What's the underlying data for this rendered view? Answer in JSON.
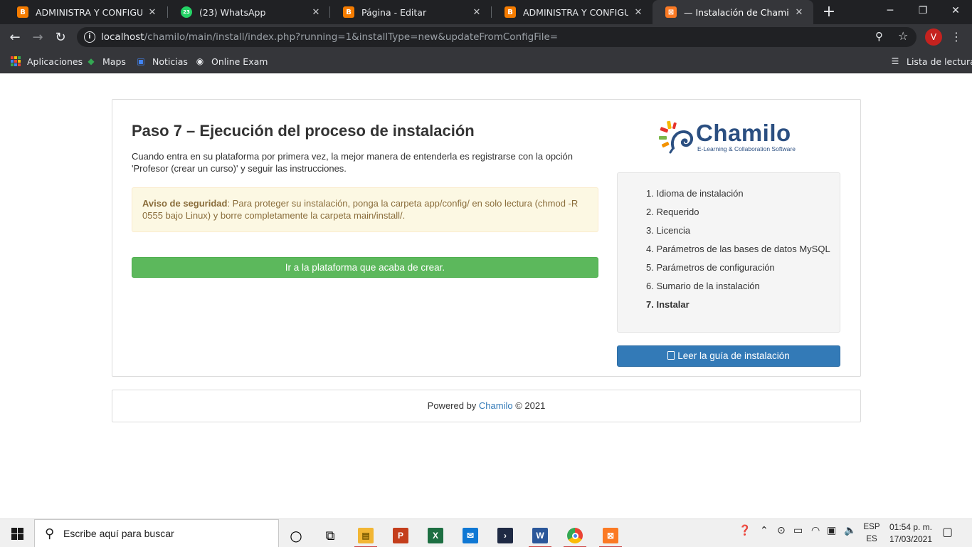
{
  "browser": {
    "tabs": [
      {
        "title": "ADMINISTRA Y CONFIGURA PL",
        "favicon": "blogger-icon"
      },
      {
        "title": "(23) WhatsApp",
        "favicon": "whatsapp-icon",
        "badge": "23"
      },
      {
        "title": "Página - Editar",
        "favicon": "blogger-icon"
      },
      {
        "title": "ADMINISTRA Y CONFIGURA PL",
        "favicon": "blogger-icon"
      },
      {
        "title": "— Instalación de Chamilo — V",
        "favicon": "xampp-icon",
        "active": true
      }
    ],
    "url_host": "localhost",
    "url_path": "/chamilo/main/install/index.php?running=1&installType=new&updateFromConfigFile=",
    "profile_initial": "V",
    "bookmarks": [
      {
        "label": "Aplicaciones",
        "icon": "apps-icon"
      },
      {
        "label": "Maps",
        "icon": "maps-icon"
      },
      {
        "label": "Noticias",
        "icon": "news-icon"
      },
      {
        "label": "Online Exam",
        "icon": "globe-icon"
      }
    ],
    "reading_list": "Lista de lectura"
  },
  "page": {
    "title": "Paso 7 – Ejecución del proceso de instalación",
    "intro": "Cuando entra en su plataforma por primera vez, la mejor manera de entenderla es registrarse con la opción 'Profesor (crear un curso)' y seguir las instrucciones.",
    "alert_label": "Aviso de seguridad",
    "alert_text": ": Para proteger su instalación, ponga la carpeta app/config/ en solo lectura (chmod -R 0555 bajo Linux) y borre completamente la carpeta main/install/.",
    "go_button": "Ir a la plataforma que acaba de crear.",
    "logo_word": "Chamilo",
    "logo_tagline": "E-Learning & Collaboration Software",
    "steps": [
      "1. Idioma de instalación",
      "2. Requerido",
      "3. Licencia",
      "4. Parámetros de las bases de datos MySQL",
      "5. Parámetros de configuración",
      "6. Sumario de la instalación",
      "7. Instalar"
    ],
    "current_step": 7,
    "guide_button": "Leer la guía de instalación",
    "footer_prefix": "Powered by ",
    "footer_link": "Chamilo",
    "footer_suffix": " © 2021"
  },
  "taskbar": {
    "search_placeholder": "Escribe aquí para buscar",
    "lang_top": "ESP",
    "lang_bottom": "ES",
    "time": "01:54 p. m.",
    "date": "17/03/2021"
  },
  "colors": {
    "accent_green": "#5cb85c",
    "accent_blue": "#337ab7",
    "warning_bg": "#fcf8e3",
    "warning_text": "#8a6d3b",
    "brand_navy": "#2b4f81"
  }
}
